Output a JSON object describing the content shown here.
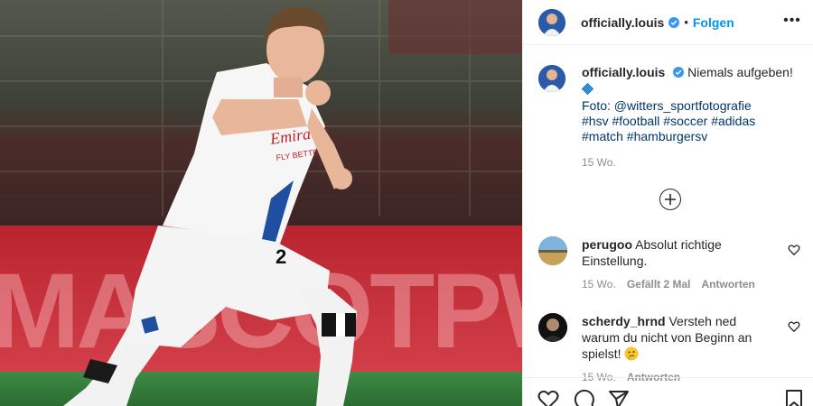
{
  "post": {
    "username": "officially.louis",
    "follow_label": "Folgen",
    "separator": "•",
    "more_label": "•••"
  },
  "caption": {
    "username": "officially.louis",
    "text": "Niemals aufgeben!",
    "photo_credit_prefix": "Foto:",
    "photo_credit_handle": "@witters_sportfotografie",
    "hashtags_line1": "#hsv #football #soccer #adidas",
    "hashtags_line2": "#match #hamburgersv",
    "age": "15 Wo."
  },
  "photo": {
    "shirt_sponsor_line1": "Emirates",
    "shirt_sponsor_line2": "FLY BETTER",
    "shirt_number": "2",
    "ad_board_text": "MASCOTPWO"
  },
  "comments": [
    {
      "username": "perugoo",
      "text": "Absolut richtige Einstellung.",
      "age": "15 Wo.",
      "likes": "Gefällt 2 Mal",
      "reply_label": "Antworten"
    },
    {
      "username": "scherdy_hrnd",
      "text": "Versteh ned warum du nicht von Beginn an spielst!",
      "age": "15 Wo.",
      "reply_label": "Antworten"
    }
  ],
  "icons": {
    "verified": "verified-badge-icon",
    "caption_emoji": "blue-diamond-emoji",
    "comment_emoji": "thinking-face-emoji",
    "load_more": "plus-circle-icon",
    "like": "heart-icon",
    "comment": "comment-bubble-icon",
    "share": "paper-plane-icon",
    "save": "bookmark-icon"
  },
  "colors": {
    "link_blue": "#00376b",
    "follow_blue": "#0095f6",
    "verified_blue": "#3897f0",
    "muted_grey": "#8e8e8e",
    "pitch_green": "#2f7a37",
    "ad_board_red": "#c8303a"
  }
}
